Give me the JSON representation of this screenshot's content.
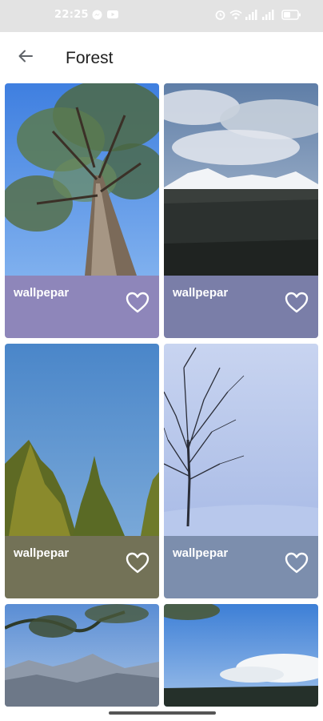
{
  "status_bar": {
    "time": "22:25",
    "icons": [
      "messenger-icon",
      "youtube-icon",
      "alarm-icon",
      "wifi-icon",
      "signal-icon",
      "signal-icon",
      "battery-icon"
    ]
  },
  "app_bar": {
    "back_icon": "arrow-left-icon",
    "title": "Forest"
  },
  "wallpapers": [
    {
      "label": "wallpepar",
      "footer_color": "#8e86ba",
      "scene": "tall-tree-blue-sky",
      "favorite_icon": "heart-outline-icon"
    },
    {
      "label": "wallpepar",
      "footer_color": "#7a7ea8",
      "scene": "snowy-mountains-forest",
      "favorite_icon": "heart-outline-icon"
    },
    {
      "label": "wallpepar",
      "footer_color": "#737257",
      "scene": "pine-trees-blue-sky",
      "favorite_icon": "heart-outline-icon"
    },
    {
      "label": "wallpepar",
      "footer_color": "#7c8ead",
      "scene": "bare-tree-snow",
      "favorite_icon": "heart-outline-icon"
    },
    {
      "label": "",
      "footer_color": "",
      "scene": "mountain-valley-branches",
      "favorite_icon": ""
    },
    {
      "label": "",
      "footer_color": "",
      "scene": "lake-sky-clouds",
      "favorite_icon": ""
    }
  ]
}
